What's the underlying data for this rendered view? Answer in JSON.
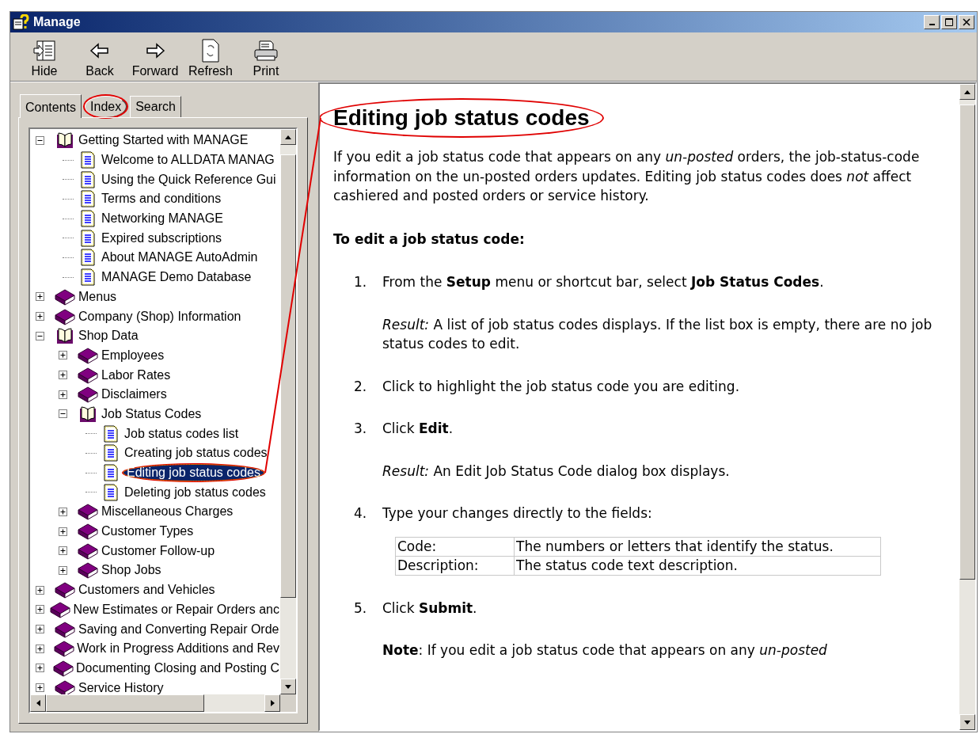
{
  "window": {
    "title": "Manage"
  },
  "toolbar": [
    {
      "label": "Hide",
      "kind": "hide"
    },
    {
      "label": "Back",
      "kind": "back"
    },
    {
      "label": "Forward",
      "kind": "forward"
    },
    {
      "label": "Refresh",
      "kind": "refresh"
    },
    {
      "label": "Print",
      "kind": "print"
    }
  ],
  "tabs": [
    {
      "label": "Contents",
      "selected": true,
      "circled": false
    },
    {
      "label": "Index",
      "selected": false,
      "circled": true
    },
    {
      "label": "Search",
      "selected": false,
      "circled": false
    }
  ],
  "tree": [
    {
      "label": "Getting Started with MANAGE",
      "kind": "book",
      "expanded": true,
      "children": [
        {
          "label": "Welcome to ALLDATA MANAG",
          "kind": "page",
          "selected": false,
          "circled": false
        },
        {
          "label": "Using the Quick Reference Gui",
          "kind": "page",
          "selected": false,
          "circled": false
        },
        {
          "label": "Terms and conditions",
          "kind": "page",
          "selected": false,
          "circled": false
        },
        {
          "label": "Networking MANAGE",
          "kind": "page",
          "selected": false,
          "circled": false
        },
        {
          "label": "Expired subscriptions",
          "kind": "page",
          "selected": false,
          "circled": false
        },
        {
          "label": "About MANAGE AutoAdmin",
          "kind": "page",
          "selected": false,
          "circled": false
        },
        {
          "label": "MANAGE Demo Database",
          "kind": "page",
          "selected": false,
          "circled": false
        }
      ]
    },
    {
      "label": "Menus",
      "kind": "book",
      "expanded": false
    },
    {
      "label": "Company (Shop) Information",
      "kind": "book",
      "expanded": false
    },
    {
      "label": "Shop Data",
      "kind": "book",
      "expanded": true,
      "children": [
        {
          "label": "Employees",
          "kind": "book",
          "expanded": false
        },
        {
          "label": "Labor Rates",
          "kind": "book",
          "expanded": false
        },
        {
          "label": "Disclaimers",
          "kind": "book",
          "expanded": false
        },
        {
          "label": "Job Status Codes",
          "kind": "book",
          "expanded": true,
          "children": [
            {
              "label": "Job status codes list",
              "kind": "page",
              "selected": false,
              "circled": false
            },
            {
              "label": "Creating job status codes",
              "kind": "page",
              "selected": false,
              "circled": false
            },
            {
              "label": "Editing job status codes",
              "kind": "page",
              "selected": true,
              "circled": true
            },
            {
              "label": "Deleting job status codes",
              "kind": "page",
              "selected": false,
              "circled": false
            }
          ]
        },
        {
          "label": "Miscellaneous Charges",
          "kind": "book",
          "expanded": false
        },
        {
          "label": "Customer Types",
          "kind": "book",
          "expanded": false
        },
        {
          "label": "Customer Follow-up",
          "kind": "book",
          "expanded": false
        },
        {
          "label": "Shop Jobs",
          "kind": "book",
          "expanded": false
        }
      ]
    },
    {
      "label": "Customers and Vehicles",
      "kind": "book",
      "expanded": false
    },
    {
      "label": "New Estimates or Repair Orders anc",
      "kind": "book",
      "expanded": false
    },
    {
      "label": "Saving and Converting Repair Orde",
      "kind": "book",
      "expanded": false
    },
    {
      "label": "Work in Progress Additions and Rev",
      "kind": "book",
      "expanded": false
    },
    {
      "label": "Documenting Closing and Posting C",
      "kind": "book",
      "expanded": false
    },
    {
      "label": "Service History",
      "kind": "book",
      "expanded": false
    }
  ],
  "content": {
    "title": "Editing job status codes",
    "title_circled": true,
    "intro": "If you edit a job status code that appears on any *un-posted* orders, the job-status-code information on the un-posted orders updates. Editing job status codes does *not* affect cashiered and posted orders or service history.",
    "procedure_title": "To edit a job status code:",
    "steps": [
      {
        "number": "1.",
        "text": "From the **Setup** menu or shortcut bar, select **Job Status Codes**.",
        "notes": [
          "*Result:* A list of job status codes displays. If the list box is empty, there are no job status codes to edit."
        ]
      },
      {
        "number": "2.",
        "text": "Click to highlight the job status code you are editing."
      },
      {
        "number": "3.",
        "text": "Click **Edit**.",
        "notes": [
          "*Result:* An Edit Job Status Code dialog box displays."
        ]
      },
      {
        "number": "4.",
        "text": "Type your changes directly to the fields:",
        "table": [
          [
            "Code:",
            "The numbers or letters that identify the status."
          ],
          [
            "Description:",
            "The status code text description."
          ]
        ]
      },
      {
        "number": "5.",
        "text": "Click **Submit**.",
        "notes": [
          "**Note**: If you edit a job status code that appears on any *un-posted*"
        ]
      }
    ]
  }
}
